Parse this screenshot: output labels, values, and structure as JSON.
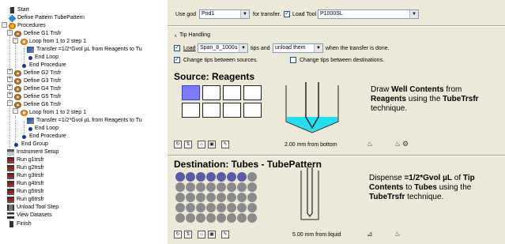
{
  "tree": {
    "items": [
      {
        "label": "Start",
        "icon": "flag-icon",
        "depth": 1
      },
      {
        "label": "Define Pattern TubePattern",
        "icon": "diamond-icon",
        "depth": 1
      },
      {
        "label": "Procedures",
        "icon": "procedures-icon",
        "depth": 0
      },
      {
        "label": "Define G1 Trsfr",
        "icon": "gear-icon",
        "depth": 1
      },
      {
        "label": "Loop from 1 to 2 step 1",
        "icon": "loop-icon",
        "depth": 2
      },
      {
        "label": "Transfer =1/2*Gvol µL from Reagents to Tu",
        "icon": "transfer-icon",
        "depth": 3
      },
      {
        "label": "End Loop",
        "icon": "dot-icon",
        "depth": 3
      },
      {
        "label": "End Procedure",
        "icon": "dot-icon",
        "depth": 2
      },
      {
        "label": "Define G2 Trsfr",
        "icon": "gear-icon",
        "depth": 1
      },
      {
        "label": "Define G3 Trsfr",
        "icon": "gear-icon",
        "depth": 1
      },
      {
        "label": "Define G4 Trsfr",
        "icon": "gear-icon",
        "depth": 1
      },
      {
        "label": "Define G5 Trsfr",
        "icon": "gear-icon",
        "depth": 1
      },
      {
        "label": "Define G6 Trsfr",
        "icon": "gear-icon",
        "depth": 1
      },
      {
        "label": "Loop from 1 to 2 step 1",
        "icon": "loop-icon",
        "depth": 2
      },
      {
        "label": "Transfer =1/2*Gvol µL from Reagents to Tu",
        "icon": "transfer-icon",
        "depth": 3
      },
      {
        "label": "End Loop",
        "icon": "dot-icon",
        "depth": 3
      },
      {
        "label": "End Procedure",
        "icon": "dot-icon",
        "depth": 2
      },
      {
        "label": "End Group",
        "icon": "dot-icon",
        "depth": 1
      },
      {
        "label": "Instrument Setup",
        "icon": "instrument-icon",
        "depth": 1
      },
      {
        "label": "Run g1trsfr",
        "icon": "run-icon",
        "depth": 1
      },
      {
        "label": "Run g2trsfr",
        "icon": "run-icon",
        "depth": 1
      },
      {
        "label": "Run g3trsfr",
        "icon": "run-icon",
        "depth": 1
      },
      {
        "label": "Run g4trsfr",
        "icon": "run-icon",
        "depth": 1
      },
      {
        "label": "Run g5trsfr",
        "icon": "run-icon",
        "depth": 1
      },
      {
        "label": "Run g6trsfr",
        "icon": "run-icon",
        "depth": 1
      },
      {
        "label": "Unload Tool Step",
        "icon": "unload-icon",
        "depth": 1
      },
      {
        "label": "View Datasets",
        "icon": "datasets-icon",
        "depth": 1
      },
      {
        "label": "Finish",
        "icon": "finish-icon",
        "depth": 1
      }
    ]
  },
  "top": {
    "use_label": "Use god",
    "pod_value": "Pod1",
    "for_transfer": "for transfer.",
    "load_tool_label": "Load Tool",
    "load_tool_value": "P1000SL",
    "load_tool_checked": true
  },
  "tip": {
    "header": "Tip Handling",
    "load_label": "Load",
    "load_checked": true,
    "tips_value": "Span_8_1000u",
    "tips_and": "tips and",
    "unload_value": "unload them",
    "when_done": "when the transfer is done.",
    "change_sources_label": "Change tips between sources.",
    "change_sources_checked": true,
    "change_dest_label": "Change tips between destinations.",
    "change_dest_checked": false
  },
  "source": {
    "title": "Source: Reagents",
    "depth_label": "2.00 mm from bottom",
    "desc_pre": "Draw ",
    "desc_b1": "Well Contents",
    "desc_mid1": " from ",
    "desc_b2": "Reagents",
    "desc_mid2": " using the ",
    "desc_b3": "TubeTrsfr",
    "desc_post": " technique.",
    "selected_color": "#7b7bff",
    "liquid_color": "#22e0f0"
  },
  "destination": {
    "title": "Destination: Tubes - TubePattern",
    "depth_label": "5.00 mm from liquid",
    "desc_pre": "Dispense ",
    "desc_b1": "=1/2*Gvol µL",
    "desc_mid1": " of ",
    "desc_b2": "Tip Contents",
    "desc_mid2": " to ",
    "desc_b3": "Tubes",
    "desc_mid3": " using the ",
    "desc_b4": "TubeTrsfr",
    "desc_post": " technique.",
    "filled_color": "#5a5aa6",
    "empty_color": "#8a8a8a"
  }
}
